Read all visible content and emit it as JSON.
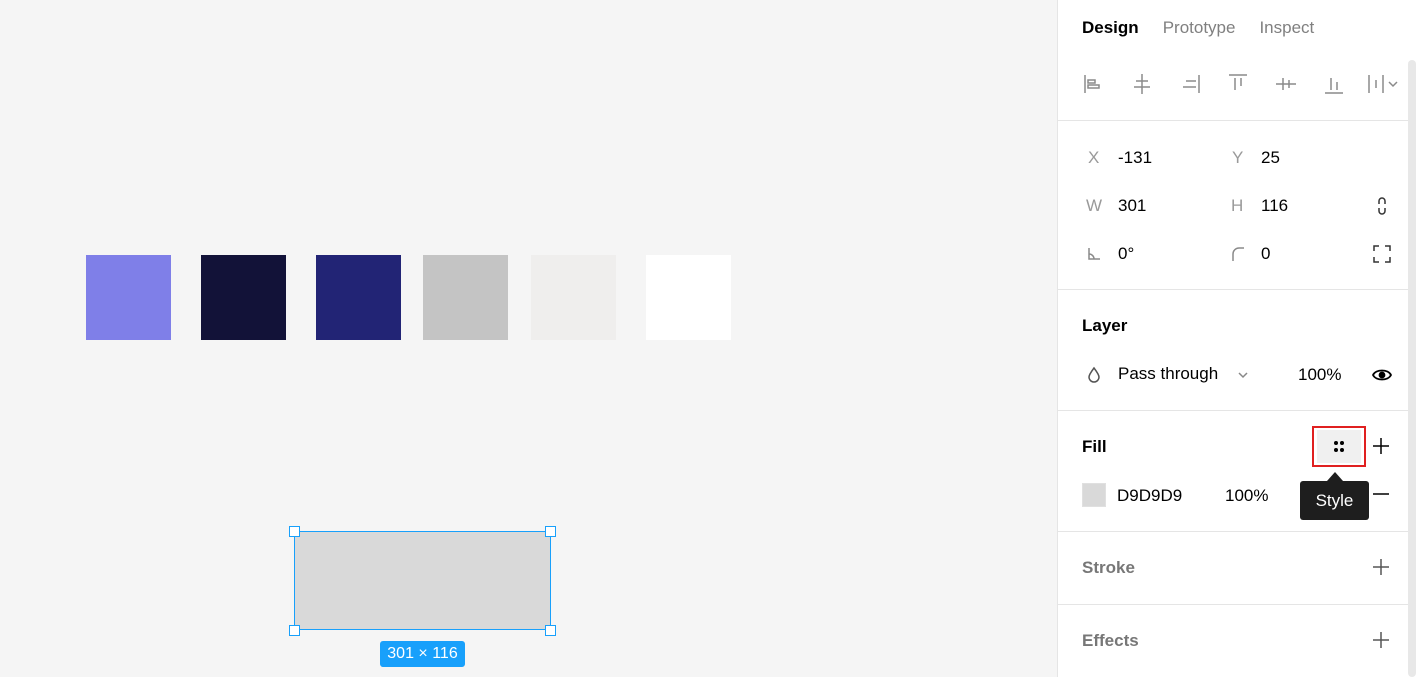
{
  "canvas": {
    "swatches": [
      {
        "name": "swatch-periwinkle",
        "color": "#7f7fe8"
      },
      {
        "name": "swatch-midnight",
        "color": "#121238"
      },
      {
        "name": "swatch-navy",
        "color": "#222475"
      },
      {
        "name": "swatch-gray",
        "color": "#c4c4c4"
      },
      {
        "name": "swatch-light-gray",
        "color": "#efeeed"
      },
      {
        "name": "swatch-white",
        "color": "#ffffff"
      }
    ],
    "selection_size_label": "301 × 116",
    "selection_color": "#18a0fb"
  },
  "panel": {
    "tabs": [
      {
        "label": "Design",
        "active": true
      },
      {
        "label": "Prototype",
        "active": false
      },
      {
        "label": "Inspect",
        "active": false
      }
    ],
    "align_icons": [
      "align-left-icon",
      "align-horizontal-center-icon",
      "align-right-icon",
      "align-top-icon",
      "align-vertical-center-icon",
      "align-bottom-icon",
      "distribute-icon"
    ],
    "props": {
      "x_label": "X",
      "x_value": "-131",
      "y_label": "Y",
      "y_value": "25",
      "w_label": "W",
      "w_value": "301",
      "h_label": "H",
      "h_value": "116",
      "rotation_value": "0°",
      "radius_value": "0"
    },
    "layer": {
      "title": "Layer",
      "blend_mode": "Pass through",
      "opacity": "100%"
    },
    "fill": {
      "title": "Fill",
      "hex": "D9D9D9",
      "opacity": "100%",
      "swatch_color": "#d9d9d9",
      "tooltip": "Style"
    },
    "stroke": {
      "title": "Stroke"
    },
    "effects": {
      "title": "Effects"
    }
  }
}
